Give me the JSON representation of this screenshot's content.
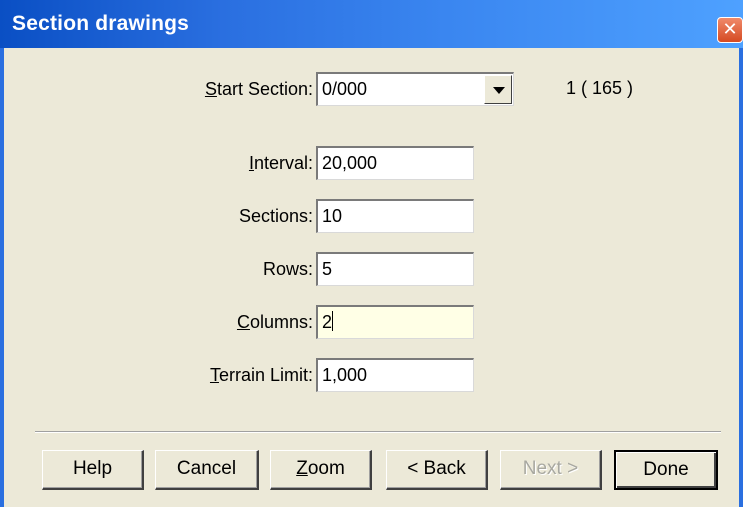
{
  "window": {
    "title": "Section drawings",
    "close_glyph": "✕"
  },
  "form": {
    "start_section": {
      "label_mnemonic": "S",
      "label_rest": "tart Section:",
      "value": "0/000",
      "count_text": "1 ( 165 )"
    },
    "interval": {
      "label_mnemonic": "I",
      "label_rest": "nterval:",
      "value": "20,000"
    },
    "sections": {
      "label": "Sections:",
      "value": "10"
    },
    "rows": {
      "label": "Rows:",
      "value": "5"
    },
    "columns": {
      "label_mnemonic": "C",
      "label_rest": "olumns:",
      "value": "2"
    },
    "terrain_limit": {
      "label_mnemonic": "T",
      "label_rest": "errain Limit:",
      "value": "1,000"
    }
  },
  "buttons": {
    "help": "Help",
    "cancel": "Cancel",
    "zoom_mnemonic": "Z",
    "zoom_rest": "oom",
    "back": "< Back",
    "next": "Next >",
    "done": "Done"
  },
  "colors": {
    "titlebar_start": "#0a4fc4",
    "titlebar_end": "#4ea1ff",
    "dialog_bg": "#ece9d8",
    "focused_field_bg": "#ffffe6",
    "close_button": "#d54a22"
  },
  "state": {
    "focused_field": "columns",
    "next_enabled": false,
    "default_button": "done"
  }
}
